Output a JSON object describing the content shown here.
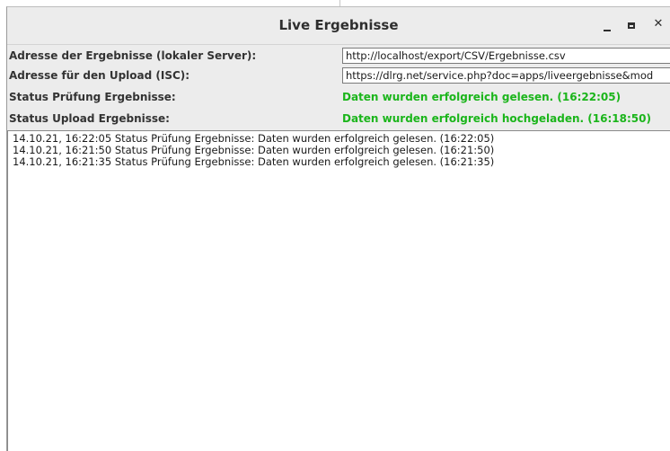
{
  "window": {
    "title": "Live Ergebnisse",
    "controls": {
      "minimize": "minimize-icon",
      "maximize": "maximize-icon",
      "close": "close-icon"
    }
  },
  "form": {
    "results_address": {
      "label": "Adresse der Ergebnisse (lokaler Server):",
      "value": "http://localhost/export/CSV/Ergebnisse.csv"
    },
    "upload_address": {
      "label": "Adresse für den Upload (ISC):",
      "value": "https://dlrg.net/service.php?doc=apps/liveergebnisse&mod"
    },
    "status_check": {
      "label": "Status Prüfung Ergebnisse:",
      "value": "Daten wurden erfolgreich gelesen. (16:22:05)"
    },
    "status_upload": {
      "label": "Status Upload Ergebnisse:",
      "value": "Daten wurden erfolgreich hochgeladen. (16:18:50)"
    }
  },
  "log": [
    "14.10.21, 16:22:05 Status Prüfung Ergebnisse: Daten wurden erfolgreich gelesen. (16:22:05)",
    "14.10.21, 16:21:50 Status Prüfung Ergebnisse: Daten wurden erfolgreich gelesen. (16:21:50)",
    "14.10.21, 16:21:35 Status Prüfung Ergebnisse: Daten wurden erfolgreich gelesen. (16:21:35)"
  ],
  "colors": {
    "status_success": "#1bb51b",
    "window_bg": "#ececec",
    "text": "#333333"
  }
}
